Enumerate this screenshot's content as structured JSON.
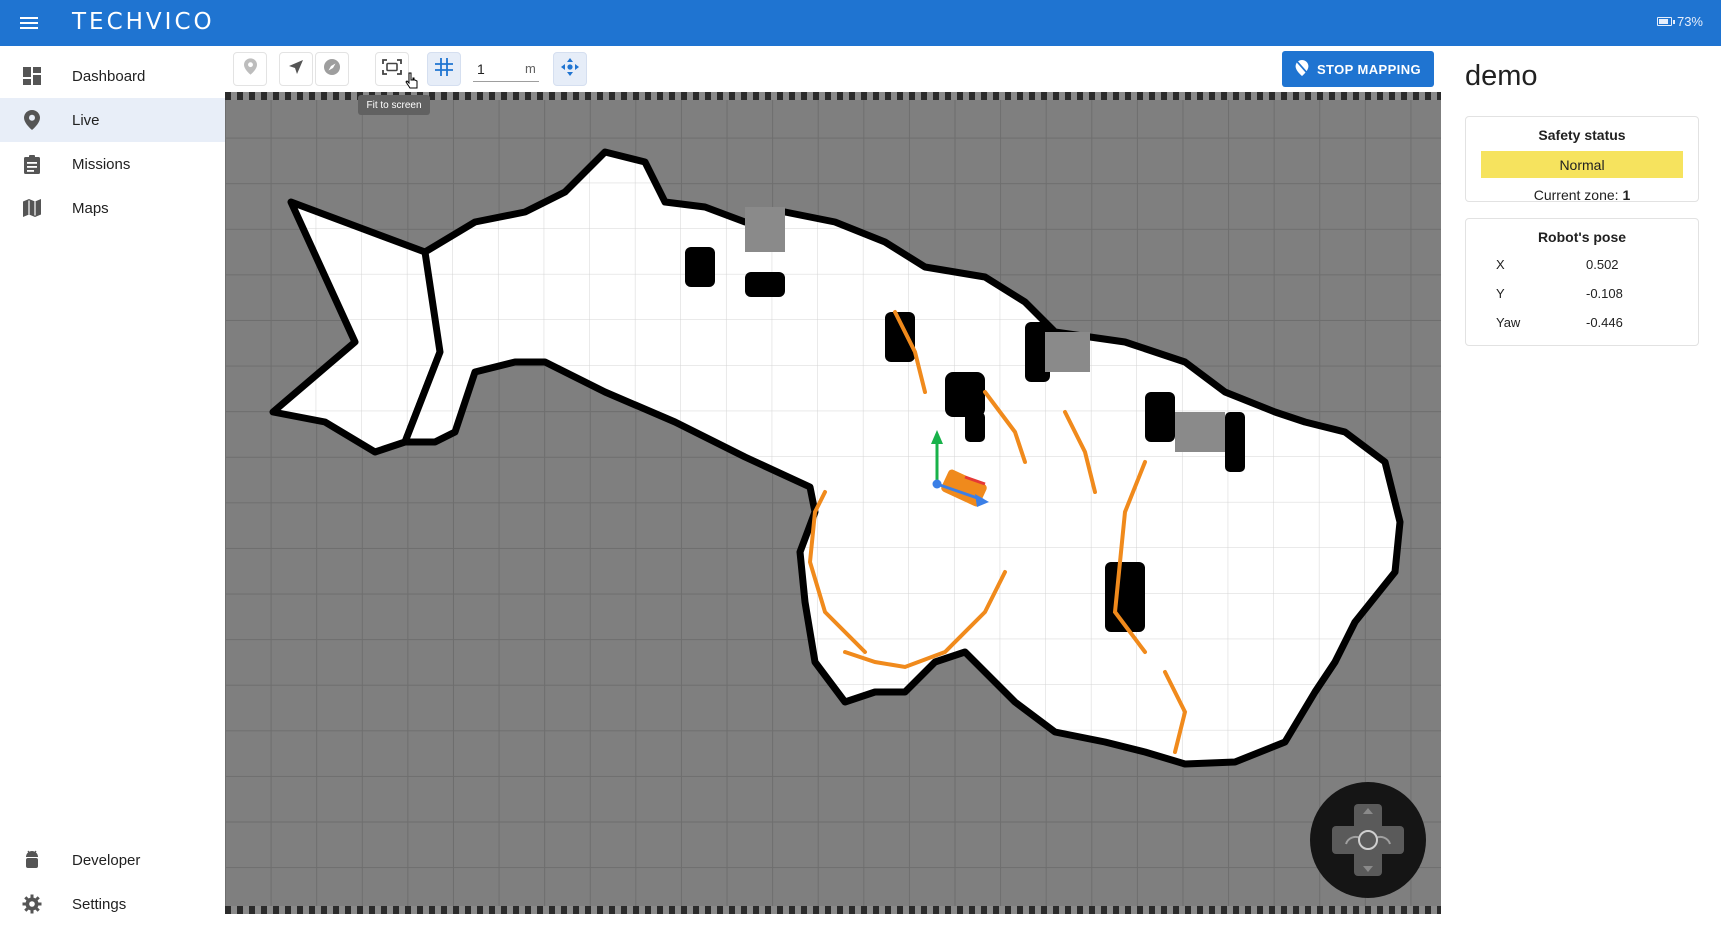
{
  "app": {
    "logo_text": "TECHVICO",
    "battery_label": "73%",
    "battery_level": 0.73,
    "accent_color": "#1f74d1"
  },
  "sidebar": {
    "top_items": [
      {
        "label": "Dashboard",
        "icon": "dashboard-icon",
        "active": false
      },
      {
        "label": "Live",
        "icon": "location-pin-icon",
        "active": true
      },
      {
        "label": "Missions",
        "icon": "clipboard-icon",
        "active": false
      },
      {
        "label": "Maps",
        "icon": "map-icon",
        "active": false
      }
    ],
    "bottom_items": [
      {
        "label": "Developer",
        "icon": "android-icon"
      },
      {
        "label": "Settings",
        "icon": "gear-icon"
      }
    ]
  },
  "toolbar": {
    "tools": [
      "set-pose-pin-icon",
      "navigate-arrow-icon",
      "compass-icon",
      "fit-to-screen-icon",
      "grid-icon",
      "joystick-toggle-icon"
    ],
    "grid_scale_value": "1",
    "grid_scale_unit": "m",
    "tooltip_text": "Fit to screen",
    "stop_mapping_label": "STOP MAPPING"
  },
  "robot_panel": {
    "robot_name": "demo",
    "safety": {
      "title": "Safety status",
      "status": "Normal",
      "status_color": "#f6e35e",
      "zone_label": "Current zone: ",
      "zone_value": "1"
    },
    "pose": {
      "title": "Robot's pose",
      "rows": [
        {
          "key": "X",
          "value": "0.502"
        },
        {
          "key": "Y",
          "value": "-0.108"
        },
        {
          "key": "Yaw",
          "value": "-0.446"
        }
      ]
    }
  },
  "map": {
    "free_color": "#ffffff",
    "unknown_color": "#7f7f7f",
    "wall_color": "#000000",
    "scan_color": "#f08a1c"
  }
}
